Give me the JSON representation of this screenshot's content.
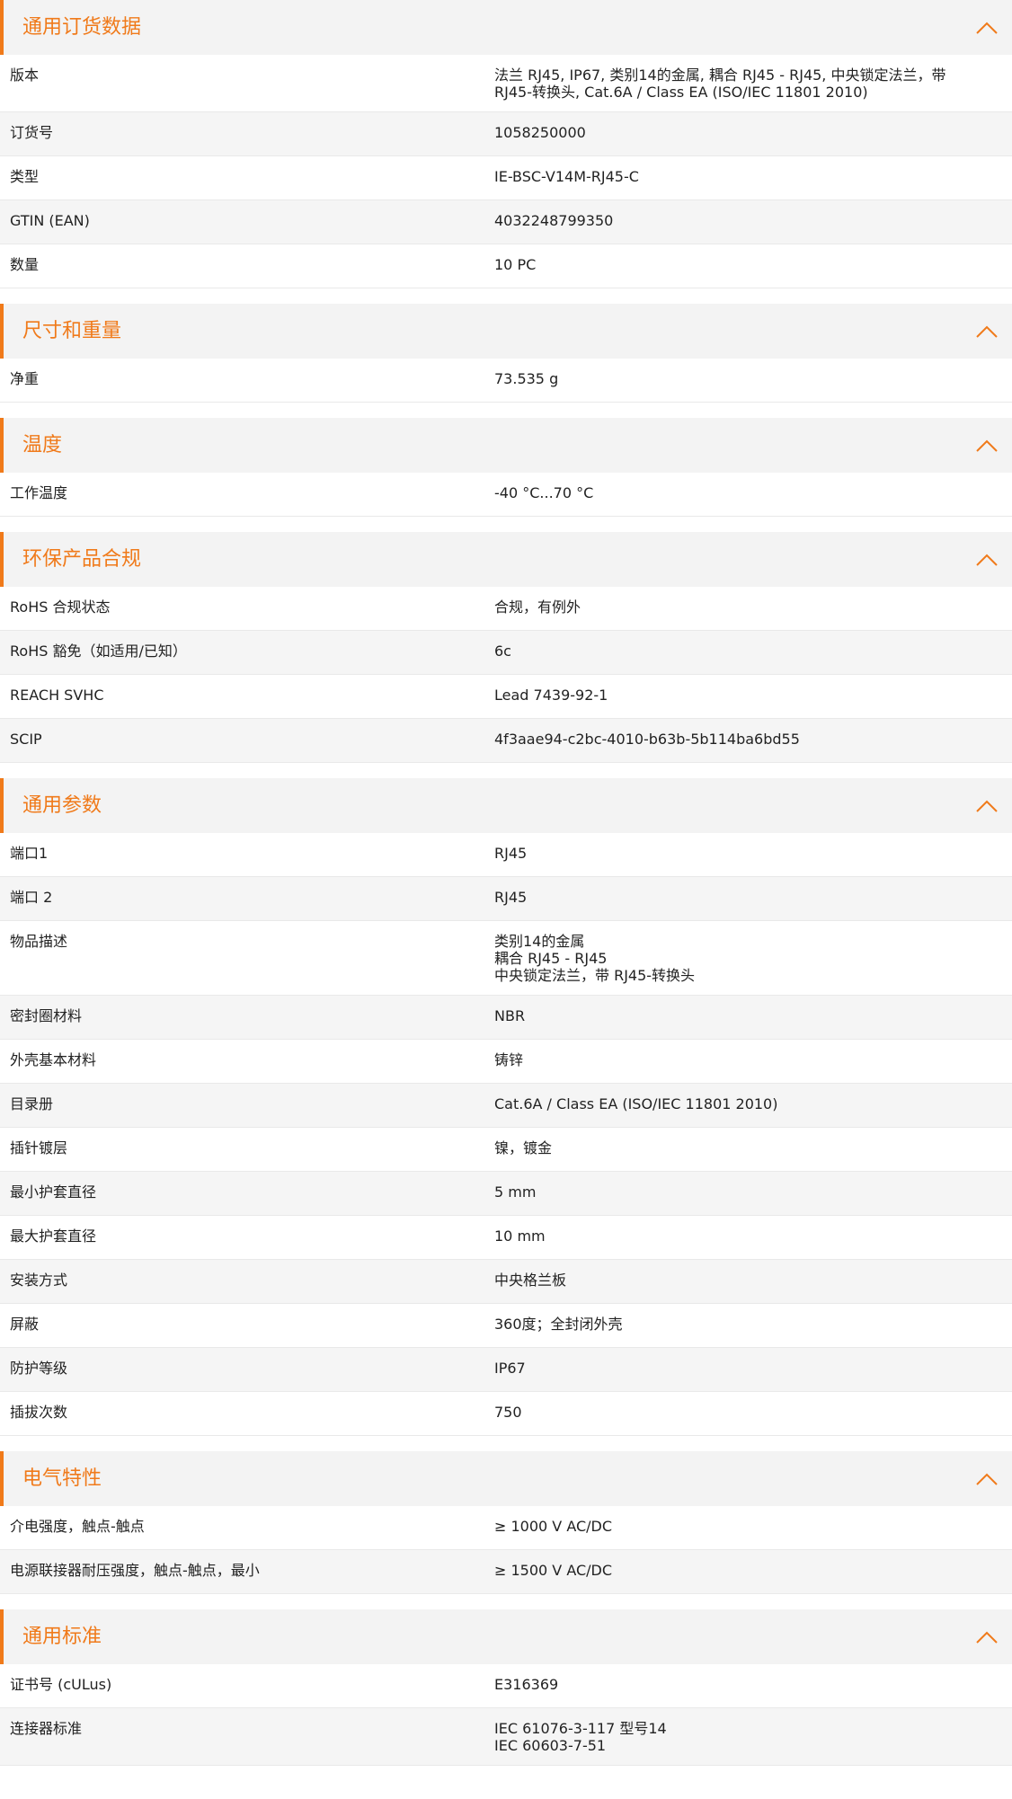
{
  "accent_color": "#f07a1a",
  "collapse_icon": "chevron-up-icon",
  "sections": [
    {
      "id": "ordering-data",
      "title": "通用订货数据",
      "rows": [
        {
          "label": "版本",
          "value": [
            "法兰 RJ45, IP67, 类别14的金属, 耦合 RJ45 - RJ45, 中央锁定法兰，带 RJ45-转换头, Cat.6A / Class EA (ISO/IEC 11801 2010)"
          ]
        },
        {
          "label": "订货号",
          "value": [
            "1058250000"
          ]
        },
        {
          "label": "类型",
          "value": [
            "IE-BSC-V14M-RJ45-C"
          ]
        },
        {
          "label": "GTIN (EAN)",
          "value": [
            "4032248799350"
          ]
        },
        {
          "label": "数量",
          "value": [
            "10  PC"
          ]
        }
      ]
    },
    {
      "id": "dimensions-weights",
      "title": "尺寸和重量",
      "rows": [
        {
          "label": "净重",
          "value": [
            "73.535  g"
          ]
        }
      ]
    },
    {
      "id": "temperatures",
      "title": "温度",
      "rows": [
        {
          "label": "工作温度",
          "value": [
            "-40 °C...70 °C"
          ]
        }
      ]
    },
    {
      "id": "environmental-compliance",
      "title": "环保产品合规",
      "rows": [
        {
          "label": "RoHS 合规状态",
          "value": [
            "合规，有例外"
          ]
        },
        {
          "label": "RoHS 豁免（如适用/已知）",
          "value": [
            "6c"
          ]
        },
        {
          "label": "REACH SVHC",
          "value": [
            "Lead 7439-92-1"
          ]
        },
        {
          "label": "SCIP",
          "value": [
            "4f3aae94-c2bc-4010-b63b-5b114ba6bd55"
          ]
        }
      ]
    },
    {
      "id": "general-parameters",
      "title": "通用参数",
      "rows": [
        {
          "label": "端口1",
          "value": [
            "RJ45"
          ]
        },
        {
          "label": "端口 2",
          "value": [
            "RJ45"
          ]
        },
        {
          "label": "物品描述",
          "value": [
            "类别14的金属",
            "耦合 RJ45 - RJ45",
            "中央锁定法兰，带 RJ45-转换头"
          ]
        },
        {
          "label": "密封圈材料",
          "value": [
            "NBR"
          ]
        },
        {
          "label": "外壳基本材料",
          "value": [
            "铸锌"
          ]
        },
        {
          "label": "目录册",
          "value": [
            "Cat.6A / Class EA (ISO/IEC 11801 2010)"
          ]
        },
        {
          "label": "插针镀层",
          "value": [
            "镍，镀金"
          ]
        },
        {
          "label": "最小护套直径",
          "value": [
            "5  mm"
          ]
        },
        {
          "label": "最大护套直径",
          "value": [
            "10  mm"
          ]
        },
        {
          "label": "安装方式",
          "value": [
            "中央格兰板"
          ]
        },
        {
          "label": "屏蔽",
          "value": [
            "360度；全封闭外壳"
          ]
        },
        {
          "label": "防护等级",
          "value": [
            "IP67"
          ]
        },
        {
          "label": "插拔次数",
          "value": [
            "750"
          ]
        }
      ]
    },
    {
      "id": "electrical-properties",
      "title": "电气特性",
      "rows": [
        {
          "label": "介电强度，触点-触点",
          "value": [
            "≥ 1000 V AC/DC"
          ]
        },
        {
          "label": "电源联接器耐压强度，触点-触点，最小",
          "value": [
            "≥ 1500 V AC/DC"
          ]
        }
      ]
    },
    {
      "id": "general-standards",
      "title": "通用标准",
      "rows": [
        {
          "label": "证书号 (cULus)",
          "value": [
            "E316369"
          ]
        },
        {
          "label": "连接器标准",
          "value": [
            "IEC 61076-3-117 型号14",
            "IEC 60603-7-51"
          ]
        }
      ]
    }
  ]
}
